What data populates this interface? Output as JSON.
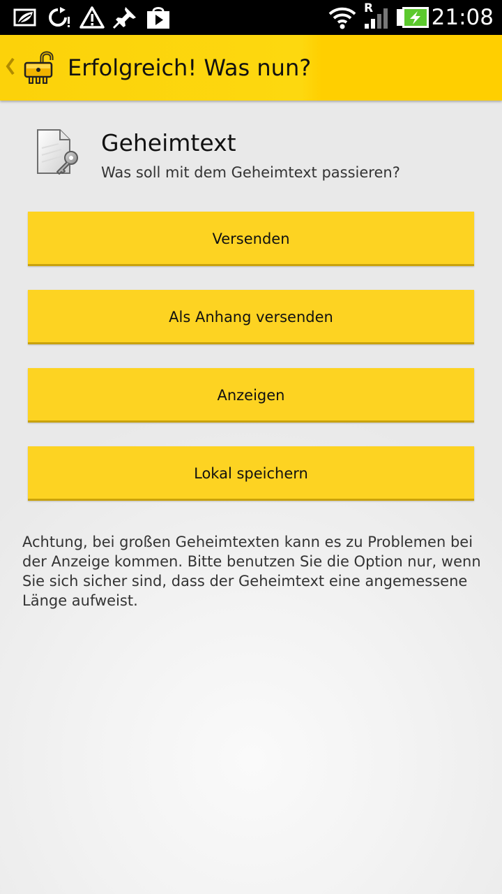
{
  "status_bar": {
    "time": "21:08",
    "roaming_label": "R",
    "icons": [
      "eco-mode-icon",
      "sync-icon",
      "warning-icon",
      "pin-icon",
      "play-store-icon",
      "wifi-icon",
      "signal-icon",
      "battery-charging-icon"
    ],
    "colors": {
      "background": "#000000",
      "battery": "#5cc92e"
    }
  },
  "action_bar": {
    "title": "Erfolgreich! Was nun?",
    "icons": [
      "up-chevron-icon",
      "unlocked-padlock-app-icon"
    ],
    "colors": {
      "background": "#fdd80f",
      "accent": "#ffcf00"
    }
  },
  "header": {
    "title": "Geheimtext",
    "subtitle": "Was soll mit dem Geheimtext passieren?",
    "icon": "secret-document-icon"
  },
  "buttons": [
    {
      "label": "Versenden"
    },
    {
      "label": "Als Anhang versenden"
    },
    {
      "label": "Anzeigen"
    },
    {
      "label": "Lokal speichern"
    }
  ],
  "button_color": "#fdd322",
  "warning_text": "Achtung, bei großen Geheimtexten kann es zu Problemen bei der Anzeige kommen. Bitte benutzen Sie die Option nur, wenn Sie sich sicher sind, dass der Geheimtext eine angemessene Länge aufweist."
}
